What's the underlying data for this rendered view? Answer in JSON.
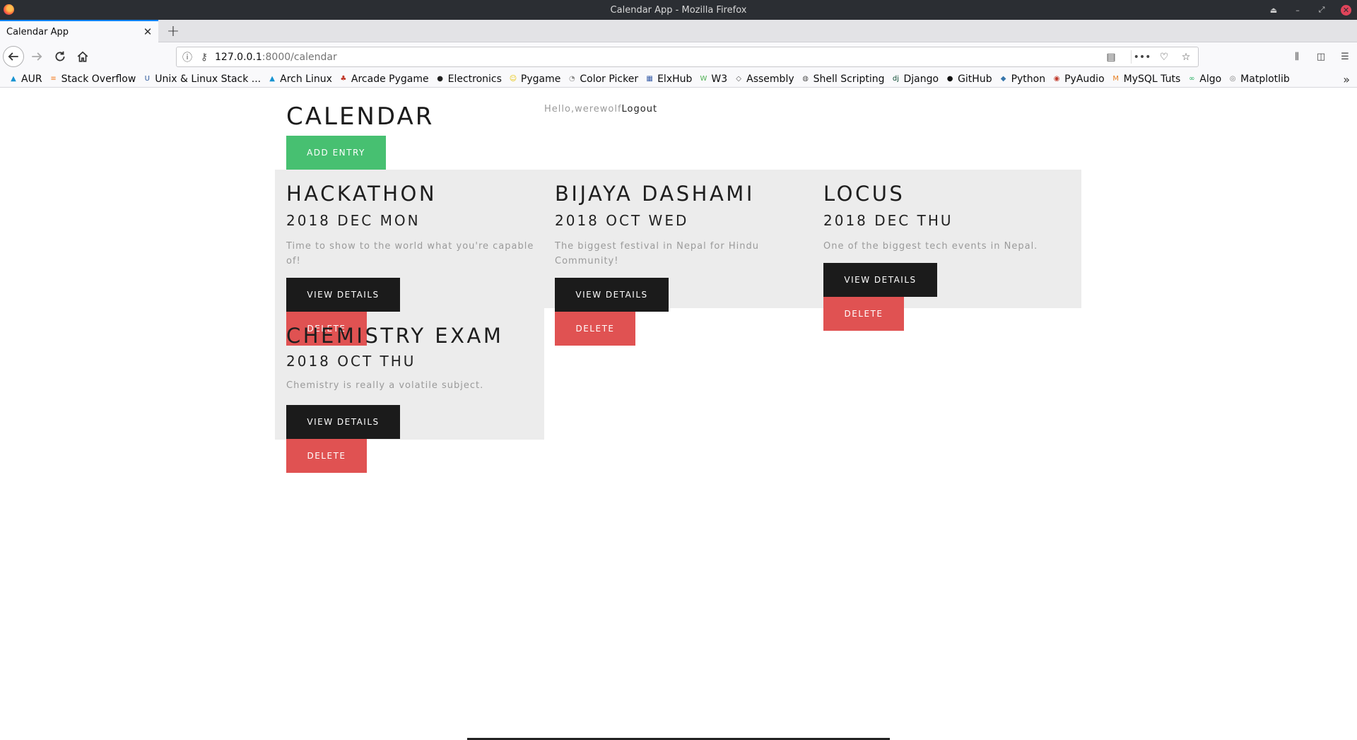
{
  "window": {
    "title": "Calendar App - Mozilla Firefox"
  },
  "tabs": [
    {
      "label": "Calendar App",
      "active": true
    }
  ],
  "urlbar": {
    "host": "127.0.0.1",
    "path": ":8000/calendar"
  },
  "bookmarks": [
    {
      "label": "AUR",
      "icon": "arch-icon",
      "color": "#1793d1"
    },
    {
      "label": "Stack Overflow",
      "icon": "stackoverflow-icon",
      "color": "#f48024"
    },
    {
      "label": "Unix & Linux Stack ...",
      "icon": "unix-icon",
      "color": "#2f5a9c"
    },
    {
      "label": "Arch Linux",
      "icon": "arch-icon",
      "color": "#1793d1"
    },
    {
      "label": "Arcade Pygame",
      "icon": "leaf-icon",
      "color": "#c0392b"
    },
    {
      "label": "Electronics",
      "icon": "circle-icon",
      "color": "#222222"
    },
    {
      "label": "Pygame",
      "icon": "pygame-icon",
      "color": "#e6c200"
    },
    {
      "label": "Color Picker",
      "icon": "palette-icon",
      "color": "#888888"
    },
    {
      "label": "ElxHub",
      "icon": "grid-icon",
      "color": "#3a5fa8"
    },
    {
      "label": "W3",
      "icon": "w3-icon",
      "color": "#4caf50"
    },
    {
      "label": "Assembly",
      "icon": "diamond-icon",
      "color": "#555555"
    },
    {
      "label": "Shell Scripting",
      "icon": "globe-icon",
      "color": "#555555"
    },
    {
      "label": "Django",
      "icon": "django-icon",
      "color": "#0c4b33"
    },
    {
      "label": "GitHub",
      "icon": "github-icon",
      "color": "#111111"
    },
    {
      "label": "Python",
      "icon": "python-icon",
      "color": "#3776ab"
    },
    {
      "label": "PyAudio",
      "icon": "pyaudio-icon",
      "color": "#c0392b"
    },
    {
      "label": "MySQL Tuts",
      "icon": "mysql-icon",
      "color": "#e67e22"
    },
    {
      "label": "Algo",
      "icon": "algo-icon",
      "color": "#27ae60"
    },
    {
      "label": "Matplotlib",
      "icon": "matplotlib-icon",
      "color": "#777777"
    }
  ],
  "page": {
    "title": "CALENDAR",
    "greeting": "Hello,werewolf",
    "logout": "Logout",
    "add_entry": "ADD ENTRY",
    "view_label": "VIEW DETAILS",
    "delete_label": "DELETE",
    "colors": {
      "add_button": "#47c071",
      "view_button": "#1b1b1b",
      "delete_button": "#e05252",
      "card_background": "#ececec"
    }
  },
  "events": [
    {
      "title": "HACKATHON",
      "date": "2018 DEC MON",
      "description": "Time to show to the world what you're capable of!"
    },
    {
      "title": "BIJAYA DASHAMI",
      "date": "2018 OCT WED",
      "description": "The biggest festival in Nepal for Hindu Community!"
    },
    {
      "title": "LOCUS",
      "date": "2018 DEC THU",
      "description": "One of the biggest tech events in Nepal."
    },
    {
      "title": "CHEMISTRY EXAM",
      "date": "2018 OCT THU",
      "description": "Chemistry is really a volatile subject."
    }
  ]
}
